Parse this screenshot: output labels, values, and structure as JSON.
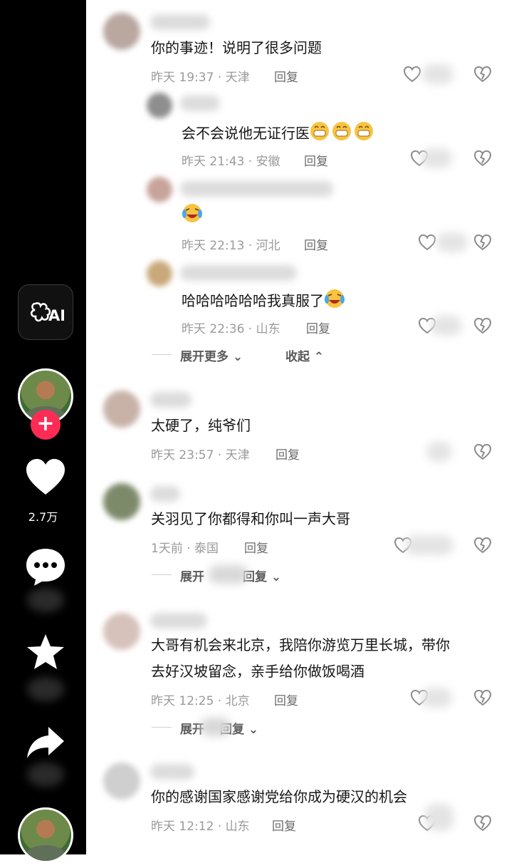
{
  "rail": {
    "ai_label": "AI",
    "like_count": "2.7万"
  },
  "comments": [
    {
      "text": "你的事迹！说明了很多问题",
      "meta": "昨天 19:37 · 天津",
      "reply": "回复"
    },
    {
      "text": "会不会说他无证行医",
      "meta": "昨天 21:43 · 安徽",
      "reply": "回复"
    },
    {
      "text": "",
      "meta": "昨天 22:13 · 河北",
      "reply": "回复"
    },
    {
      "text": "哈哈哈哈哈哈我真服了",
      "meta": "昨天 22:36 · 山东",
      "reply": "回复"
    },
    {
      "text": "太硬了，纯爷们",
      "meta": "昨天 23:57 · 天津",
      "reply": "回复"
    },
    {
      "text": "关羽见了你都得和你叫一声大哥",
      "meta": "1天前 · 泰国",
      "reply": "回复"
    },
    {
      "text": "大哥有机会来北京，我陪你游览万里长城，带你",
      "text2": "去好汉坡留念，亲手给你做饭喝酒",
      "meta": "昨天 12:25 · 北京",
      "reply": "回复"
    },
    {
      "text": "你的感谢国家感谢党给你成为硬汉的机会",
      "meta": "昨天 12:12 · 山东",
      "reply": "回复"
    }
  ],
  "expanders": {
    "show_more": "展开更多",
    "collapse": "收起",
    "expand_prefix": "展开",
    "expand_suffix": "回复"
  },
  "emoji_names": [
    "grin-emoji",
    "laugh-cry-emoji"
  ],
  "colors": {
    "accent": "#fe2c55",
    "rail_bg": "#000000",
    "meta_text": "#9a9a9a"
  }
}
